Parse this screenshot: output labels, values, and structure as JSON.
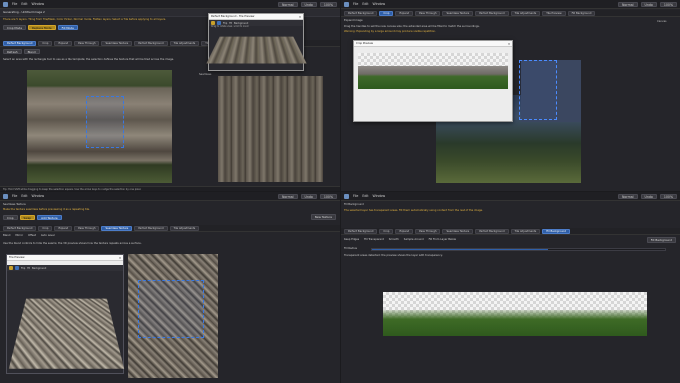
{
  "app": {
    "menu": [
      "File",
      "Edit",
      "Window"
    ],
    "mode": "Normal",
    "undo_label": "Undo",
    "zoom": "100%"
  },
  "pane_tl": {
    "title": "Generating - Untitled Image 2",
    "crop_tabs": [
      "Crop Mode",
      "Replace Mode",
      "Fill Mode"
    ],
    "warning": "There are 5 layers. Tiling from Tile/Mask, Color Picker, Normal mode, Flatten layers; Select a Tile before applying to all layers.",
    "tabs": [
      "Perfect Background",
      "Crop",
      "Expand",
      "Pass Through",
      "Seamless Texture",
      "Perfect Background",
      "Tile Adjustments",
      "Tile Preview",
      "Fill Background"
    ],
    "active_tab": "Perfect Background",
    "buttons": [
      "Refresh",
      "Blend"
    ],
    "body_text": "Select an area with the rectangle tool to use as a tile template; the selection defines the texture that will be tiled across the image.",
    "status": "Tip: Hold Shift while dragging to keep the selection square. Use the arrow keys to nudge the selection by one pixel.",
    "dialog_title": "Perfect Background - Tile Preview",
    "dialog_tools": [
      "Flip",
      "Fit",
      "Background"
    ],
    "dialog_note": "Drag to rotate view, scroll to zoom",
    "side_label": "Seamless"
  },
  "pane_tr": {
    "title": "Expand Image",
    "tabs": [
      "Perfect Background",
      "Crop",
      "Expand",
      "Pass Through",
      "Seamless Texture",
      "Perfect Background",
      "Tile Adjustments",
      "Tile Preview",
      "Fill Background"
    ],
    "active_tab": "Crop",
    "text_line": "Drag the handles to set the new canvas size; the extended area will be filled to match the surroundings.",
    "warning": "Warning: Expanding by a large amount may produce visible repetition.",
    "dialog_title": "Crop Preview",
    "side_label": "Canvas"
  },
  "pane_bl": {
    "title": "Texture - Tile Preview",
    "header_label": "Seamless Texture",
    "warning": "Make the texture seamless before previewing it as a repeating tile.",
    "buttons": [
      "Crop",
      "Swap",
      "Add Texture"
    ],
    "tabs": [
      "Perfect Background",
      "Crop",
      "Expand",
      "Pass Through",
      "Seamless Texture",
      "Perfect Background",
      "Tile Adjustments"
    ],
    "active_tab": "Seamless Texture",
    "options": [
      "Blend",
      "Mirror",
      "Offset",
      "Auto Level"
    ],
    "body_text": "Use the blend controls to hide the seams; the 3D preview shows how the texture repeats across a surface.",
    "dialog_title": "Tile Preview",
    "dialog_tools": [
      "Flip",
      "Fit",
      "Background"
    ],
    "right_button": "New Texture"
  },
  "pane_br": {
    "title": "Fill Background",
    "header_label": "Fill Background",
    "warning": "The selected layer has transparent areas. Fill them automatically using content from the rest of the image.",
    "tabs": [
      "Perfect Background",
      "Crop",
      "Expand",
      "Pass Through",
      "Seamless Texture",
      "Perfect Background",
      "Tile Adjustments",
      "Fill Background"
    ],
    "active_tab": "Fill Background",
    "checks": [
      "Keep Edges",
      "Fill Transparent",
      "Smooth",
      "Sample Around",
      "Fill From Layer Below"
    ],
    "slider_label": "Fill Radius",
    "slider_value": 0.6,
    "side_button": "Fill Background",
    "status": "Transparent areas detected: the preview shows the layer with transparency."
  },
  "colors": {
    "accent": "#2f5fa8",
    "warning": "#e3b341",
    "background": "#25252a"
  }
}
